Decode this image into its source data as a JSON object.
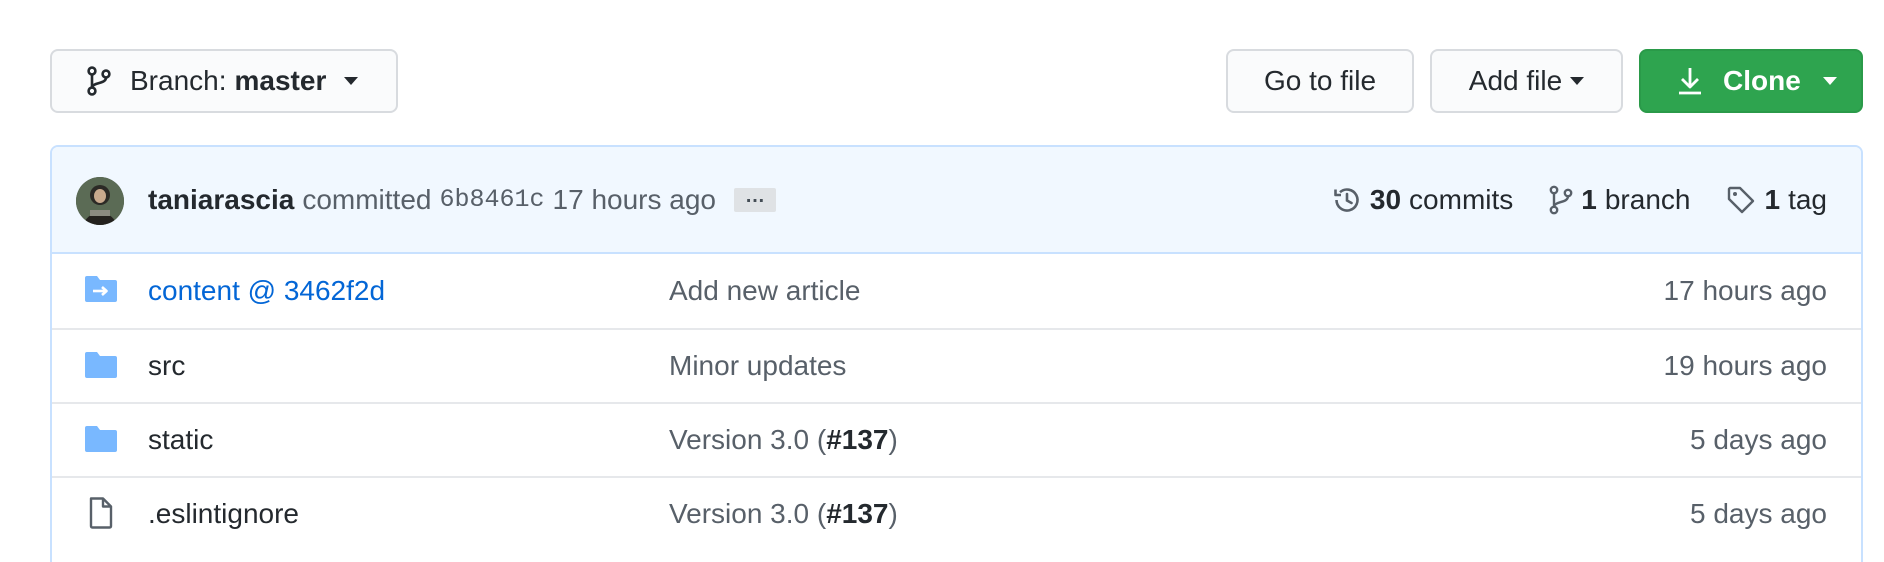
{
  "toolbar": {
    "branch_prefix": "Branch:",
    "branch_name": "master",
    "goto_label": "Go to file",
    "add_file_label": "Add file",
    "clone_label": "Clone"
  },
  "commit": {
    "author": "taniarascia",
    "verb": "committed",
    "sha": "6b8461c",
    "time": "17 hours ago",
    "ellipsis": "…"
  },
  "stats": {
    "commits_count": "30",
    "commits_label": "commits",
    "branches_count": "1",
    "branches_label": "branch",
    "tags_count": "1",
    "tags_label": "tag"
  },
  "files": [
    {
      "name": "content @ 3462f2d",
      "message": "Add new article",
      "pr": "",
      "age": "17 hours ago"
    },
    {
      "name": "src",
      "message": "Minor updates",
      "pr": "",
      "age": "19 hours ago"
    },
    {
      "name": "static",
      "message": "Version 3.0 (",
      "pr": "#137",
      "message_end": ")",
      "age": "5 days ago"
    },
    {
      "name": ".eslintignore",
      "message": "Version 3.0 (",
      "pr": "#137",
      "message_end": ")",
      "age": "5 days ago"
    }
  ],
  "colors": {
    "clone_button": "#2ea44f",
    "commit_bar_bg": "#f1f8ff",
    "folder_icon": "#79b8ff",
    "link": "#0366d6"
  }
}
